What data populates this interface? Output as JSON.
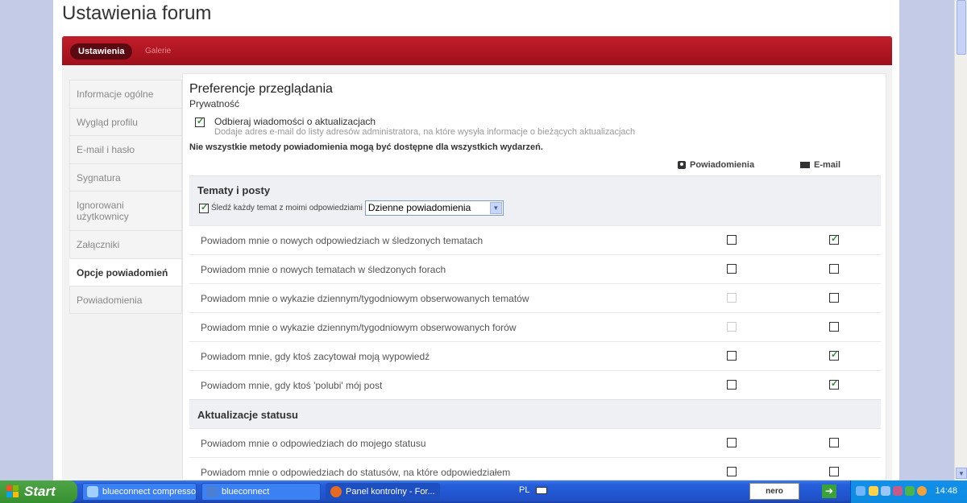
{
  "page": {
    "title": "Ustawienia forum"
  },
  "tabs": {
    "active": "Ustawienia",
    "other": "Galerie"
  },
  "sidebar": {
    "items": [
      {
        "label": "Informacje ogólne"
      },
      {
        "label": "Wygląd profilu"
      },
      {
        "label": "E-mail i hasło"
      },
      {
        "label": "Sygnatura"
      },
      {
        "label": "Ignorowani użytkownicy"
      },
      {
        "label": "Załączniki"
      },
      {
        "label": "Opcje powiadomień"
      },
      {
        "label": "Powiadomienia"
      }
    ],
    "active_index": 6
  },
  "main": {
    "title": "Preferencje przeglądania",
    "privacy_label": "Prywatność",
    "option": {
      "label": "Odbieraj wiadomości o aktualizacjach",
      "description": "Dodaje adres e-mail do listy adresów administratora, na które wysyła informacje o bieżących aktualizacjach",
      "checked": true
    },
    "note": "Nie wszystkie metody powiadomienia mogą być dostępne dla wszystkich wydarzeń.",
    "columns": {
      "notifications": "Powiadomienia",
      "email": "E-mail"
    },
    "groups": [
      {
        "title": "Tematy i posty",
        "track": {
          "label": "Śledź każdy temat z moimi odpowiedziami",
          "checked": true,
          "select_value": "Dzienne powiadomienia"
        },
        "rows": [
          {
            "label": "Powiadom mnie o nowych odpowiedziach w śledzonych tematach",
            "notify": "off",
            "email": "on"
          },
          {
            "label": "Powiadom mnie o nowych tematach w śledzonych forach",
            "notify": "off",
            "email": "off"
          },
          {
            "label": "Powiadom mnie o wykazie dziennym/tygodniowym obserwowanych tematów",
            "notify": "disabled",
            "email": "off"
          },
          {
            "label": "Powiadom mnie o wykazie dziennym/tygodniowym obserwowanych forów",
            "notify": "disabled",
            "email": "off"
          },
          {
            "label": "Powiadom mnie, gdy ktoś zacytował moją wypowiedź",
            "notify": "off",
            "email": "on"
          },
          {
            "label": "Powiadom mnie, gdy ktoś 'polubi' mój post",
            "notify": "off",
            "email": "on"
          }
        ]
      },
      {
        "title": "Aktualizacje statusu",
        "rows": [
          {
            "label": "Powiadom mnie o odpowiedziach do mojego statusu",
            "notify": "off",
            "email": "off"
          },
          {
            "label": "Powiadom mnie o odpowiedziach do statusów, na które odpowiedziałem",
            "notify": "off",
            "email": "off"
          }
        ]
      }
    ]
  },
  "taskbar": {
    "start_label": "Start",
    "tasks": [
      {
        "label": "blueconnect compressor",
        "icon_color": "#9fd0ff",
        "icon": "compressor-icon"
      },
      {
        "label": "blueconnect",
        "icon_color": "#4a7fd4",
        "icon": "bc-icon"
      },
      {
        "label": "Panel kontrolny - For...",
        "icon_color": "#e66a1f",
        "icon": "firefox-icon"
      }
    ],
    "language": "PL",
    "search_brand": "nero",
    "clock": "14:48"
  }
}
